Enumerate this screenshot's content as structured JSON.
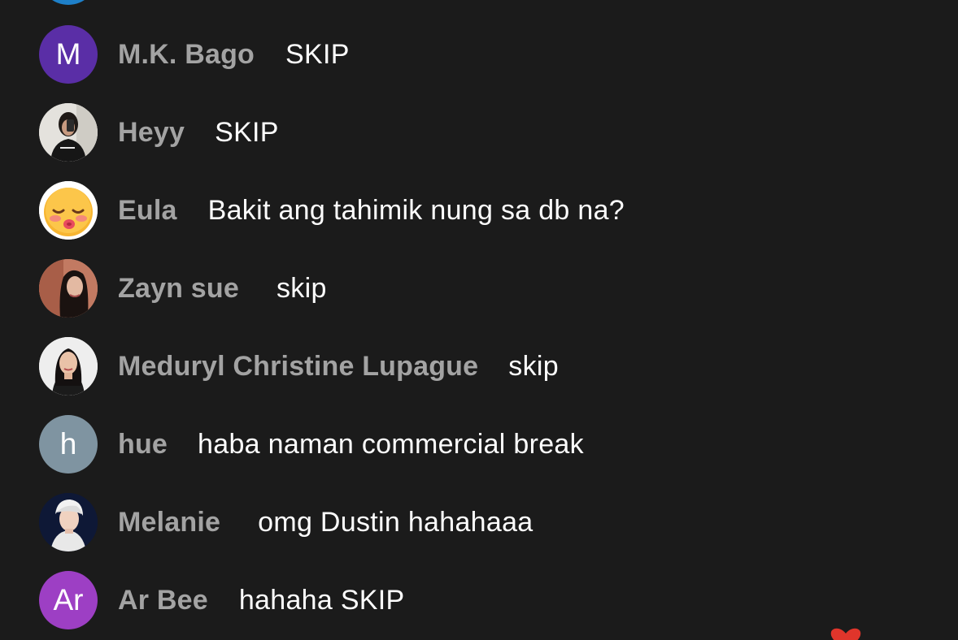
{
  "chat": {
    "messages": [
      {
        "avatar_letter": "M",
        "avatar_color": "#5a2ea6",
        "name": "M.K. Bago",
        "text": "SKIP"
      },
      {
        "avatar_letter": "",
        "avatar_type": "photo",
        "name": "Heyy",
        "text": "SKIP"
      },
      {
        "avatar_letter": "",
        "avatar_type": "emoji",
        "name": "Eula",
        "text": "Bakit ang tahimik nung sa db na?"
      },
      {
        "avatar_letter": "",
        "avatar_type": "photo",
        "name": "Zayn sue",
        "text": "skip"
      },
      {
        "avatar_letter": "",
        "avatar_type": "photo",
        "name": "Meduryl Christine Lupague",
        "text": "skip"
      },
      {
        "avatar_letter": "h",
        "avatar_color": "#7f94a1",
        "name": "hue",
        "text": "haba naman commercial break"
      },
      {
        "avatar_letter": "",
        "avatar_type": "photo",
        "name": "Melanie",
        "text": "omg Dustin hahahaaa"
      },
      {
        "avatar_letter": "Ar",
        "avatar_color": "#9d3fc4",
        "name": "Ar Bee",
        "text": "hahaha SKIP"
      }
    ]
  },
  "colors": {
    "background": "#1b1b1b",
    "name_text": "#a3a3a3",
    "message_text": "#fdfdfd",
    "top_partial_avatar": "#1e80c9",
    "heart": "#e0352b"
  }
}
